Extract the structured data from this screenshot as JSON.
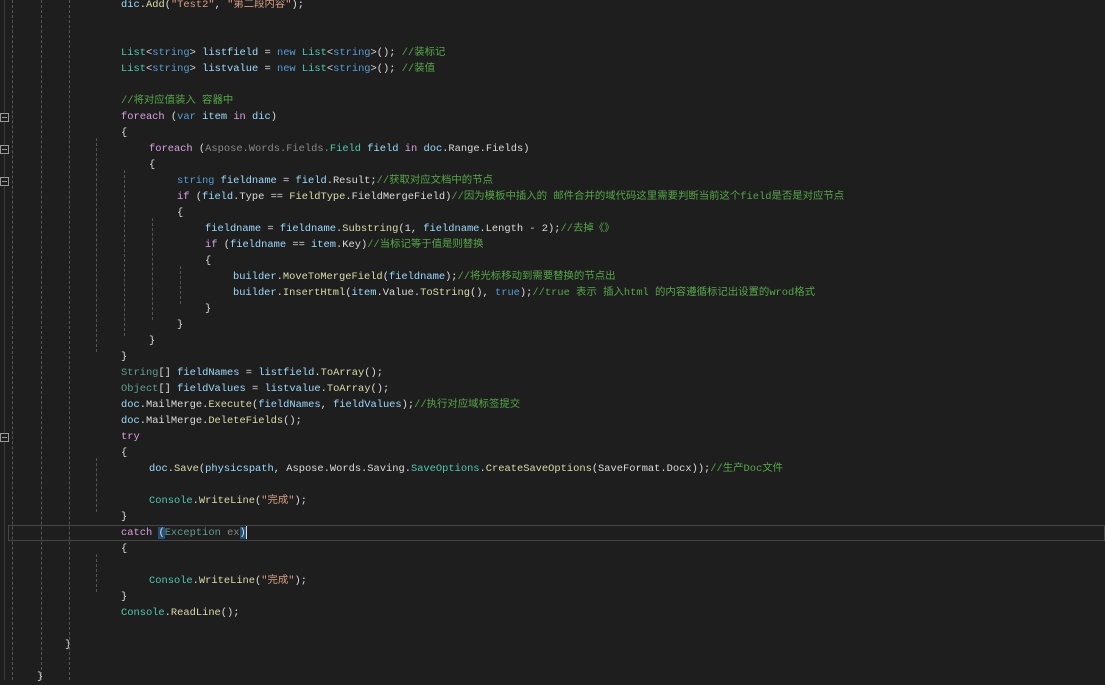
{
  "editor": {
    "current_line": 33,
    "lines": [
      {
        "i": 3,
        "t": [
          [
            "dic",
            "var"
          ],
          [
            ".",
            ""
          ],
          [
            "Add",
            "fn"
          ],
          [
            "(",
            ""
          ],
          [
            "\"Test2\"",
            "str"
          ],
          [
            ", ",
            ""
          ],
          [
            "\"第二段内容\"",
            "str"
          ],
          [
            ");",
            ""
          ]
        ]
      },
      {
        "i": 0,
        "t": []
      },
      {
        "i": 0,
        "t": []
      },
      {
        "i": 3,
        "t": [
          [
            "List",
            "typ"
          ],
          [
            "<",
            ""
          ],
          [
            "string",
            "kw"
          ],
          [
            "> ",
            ""
          ],
          [
            "listfield",
            "var"
          ],
          [
            " = ",
            ""
          ],
          [
            "new",
            "kw"
          ],
          [
            " ",
            ""
          ],
          [
            "List",
            "typ"
          ],
          [
            "<",
            ""
          ],
          [
            "string",
            "kw"
          ],
          [
            ">(); ",
            ""
          ],
          [
            "//装标记",
            "cmt"
          ]
        ]
      },
      {
        "i": 3,
        "t": [
          [
            "List",
            "typ"
          ],
          [
            "<",
            ""
          ],
          [
            "string",
            "kw"
          ],
          [
            "> ",
            ""
          ],
          [
            "listvalue",
            "var"
          ],
          [
            " = ",
            ""
          ],
          [
            "new",
            "kw"
          ],
          [
            " ",
            ""
          ],
          [
            "List",
            "typ"
          ],
          [
            "<",
            ""
          ],
          [
            "string",
            "kw"
          ],
          [
            ">(); ",
            ""
          ],
          [
            "//装值",
            "cmt"
          ]
        ]
      },
      {
        "i": 0,
        "t": []
      },
      {
        "i": 3,
        "t": [
          [
            "//将对应值装入 容器中",
            "cmt"
          ]
        ]
      },
      {
        "i": 3,
        "t": [
          [
            "foreach",
            "ctl"
          ],
          [
            " (",
            ""
          ],
          [
            "var",
            "kw"
          ],
          [
            " ",
            ""
          ],
          [
            "item",
            "var"
          ],
          [
            " ",
            ""
          ],
          [
            "in",
            "ctl"
          ],
          [
            " ",
            ""
          ],
          [
            "dic",
            "var"
          ],
          [
            ")",
            ""
          ]
        ]
      },
      {
        "i": 3,
        "t": [
          [
            "{",
            ""
          ]
        ]
      },
      {
        "i": 4,
        "t": [
          [
            "foreach",
            "ctl"
          ],
          [
            " (",
            ""
          ],
          [
            "Aspose.Words.Fields.",
            "dim"
          ],
          [
            "Field",
            "typ"
          ],
          [
            " ",
            ""
          ],
          [
            "field",
            "var"
          ],
          [
            " ",
            ""
          ],
          [
            "in",
            "ctl"
          ],
          [
            " ",
            ""
          ],
          [
            "doc",
            "var"
          ],
          [
            ".Range.Fields)",
            ""
          ]
        ]
      },
      {
        "i": 4,
        "t": [
          [
            "{",
            ""
          ]
        ]
      },
      {
        "i": 5,
        "t": [
          [
            "string",
            "kw"
          ],
          [
            " ",
            ""
          ],
          [
            "fieldname",
            "var"
          ],
          [
            " = ",
            ""
          ],
          [
            "field",
            "var"
          ],
          [
            ".Result;",
            ""
          ],
          [
            "//获取对应文档中的节点",
            "cmt"
          ]
        ]
      },
      {
        "i": 5,
        "t": [
          [
            "if",
            "ctl"
          ],
          [
            " (",
            ""
          ],
          [
            "field",
            "var"
          ],
          [
            ".Type == ",
            ""
          ],
          [
            "FieldType",
            "fn"
          ],
          [
            ".FieldMergeField)",
            ""
          ],
          [
            "//因为模板中插入的 邮件合并的域代码这里需要判断当前这个field是否是对应节点",
            "cmt"
          ]
        ]
      },
      {
        "i": 5,
        "t": [
          [
            "{",
            ""
          ]
        ]
      },
      {
        "i": 6,
        "t": [
          [
            "fieldname",
            "var"
          ],
          [
            " = ",
            ""
          ],
          [
            "fieldname",
            "var"
          ],
          [
            ".",
            ""
          ],
          [
            "Substring",
            "fn"
          ],
          [
            "(1, ",
            ""
          ],
          [
            "fieldname",
            "var"
          ],
          [
            ".Length - 2);",
            ""
          ],
          [
            "//去掉《》",
            "cmt"
          ]
        ]
      },
      {
        "i": 6,
        "t": [
          [
            "if",
            "ctl"
          ],
          [
            " (",
            ""
          ],
          [
            "fieldname",
            "var"
          ],
          [
            " == ",
            ""
          ],
          [
            "item",
            "var"
          ],
          [
            ".Key)",
            ""
          ],
          [
            "//当标记等于值是则替换",
            "cmt"
          ]
        ]
      },
      {
        "i": 6,
        "t": [
          [
            "{",
            ""
          ]
        ]
      },
      {
        "i": 7,
        "t": [
          [
            "builder",
            "var"
          ],
          [
            ".",
            ""
          ],
          [
            "MoveToMergeField",
            "fn"
          ],
          [
            "(",
            ""
          ],
          [
            "fieldname",
            "var"
          ],
          [
            ");",
            ""
          ],
          [
            "//将光标移动到需要替换的节点出",
            "cmt"
          ]
        ]
      },
      {
        "i": 7,
        "t": [
          [
            "builder",
            "var"
          ],
          [
            ".",
            ""
          ],
          [
            "InsertHtml",
            "fn"
          ],
          [
            "(",
            ""
          ],
          [
            "item",
            "var"
          ],
          [
            ".Value.",
            ""
          ],
          [
            "ToString",
            "fn"
          ],
          [
            "(), ",
            ""
          ],
          [
            "true",
            "kw"
          ],
          [
            ");",
            ""
          ],
          [
            "//true 表示 插入html 的内容遵循标记出设置的wrod格式",
            "cmt"
          ]
        ]
      },
      {
        "i": 6,
        "t": [
          [
            "}",
            ""
          ]
        ]
      },
      {
        "i": 5,
        "t": [
          [
            "}",
            ""
          ]
        ]
      },
      {
        "i": 4,
        "t": [
          [
            "}",
            ""
          ]
        ]
      },
      {
        "i": 3,
        "t": [
          [
            "}",
            ""
          ]
        ]
      },
      {
        "i": 3,
        "t": [
          [
            "String",
            "dimtyp"
          ],
          [
            "[] ",
            ""
          ],
          [
            "fieldNames",
            "var"
          ],
          [
            " = ",
            ""
          ],
          [
            "listfield",
            "var"
          ],
          [
            ".",
            ""
          ],
          [
            "ToArray",
            "fn"
          ],
          [
            "();",
            ""
          ]
        ]
      },
      {
        "i": 3,
        "t": [
          [
            "Object",
            "dimtyp"
          ],
          [
            "[] ",
            ""
          ],
          [
            "fieldValues",
            "var"
          ],
          [
            " = ",
            ""
          ],
          [
            "listvalue",
            "var"
          ],
          [
            ".",
            ""
          ],
          [
            "ToArray",
            "fn"
          ],
          [
            "();",
            ""
          ]
        ]
      },
      {
        "i": 3,
        "t": [
          [
            "doc",
            "var"
          ],
          [
            ".MailMerge.",
            ""
          ],
          [
            "Execute",
            "fn"
          ],
          [
            "(",
            ""
          ],
          [
            "fieldNames",
            "var"
          ],
          [
            ", ",
            ""
          ],
          [
            "fieldValues",
            "var"
          ],
          [
            ");",
            ""
          ],
          [
            "//执行对应域标签提交",
            "cmt"
          ]
        ]
      },
      {
        "i": 3,
        "t": [
          [
            "doc",
            "var"
          ],
          [
            ".MailMerge.",
            ""
          ],
          [
            "DeleteFields",
            "fn"
          ],
          [
            "();",
            ""
          ]
        ]
      },
      {
        "i": 3,
        "t": [
          [
            "try",
            "ctl"
          ]
        ]
      },
      {
        "i": 3,
        "t": [
          [
            "{",
            ""
          ]
        ]
      },
      {
        "i": 4,
        "t": [
          [
            "doc",
            "var"
          ],
          [
            ".",
            ""
          ],
          [
            "Save",
            "fn"
          ],
          [
            "(",
            ""
          ],
          [
            "physicspath",
            "var"
          ],
          [
            ", Aspose.Words.Saving.",
            ""
          ],
          [
            "SaveOptions",
            "typ"
          ],
          [
            ".",
            ""
          ],
          [
            "CreateSaveOptions",
            "fn"
          ],
          [
            "(SaveFormat.Docx));",
            ""
          ],
          [
            "//生产Doc文件",
            "cmt"
          ]
        ]
      },
      {
        "i": 0,
        "t": []
      },
      {
        "i": 4,
        "t": [
          [
            "Console",
            "typ"
          ],
          [
            ".",
            ""
          ],
          [
            "WriteLine",
            "fn"
          ],
          [
            "(",
            ""
          ],
          [
            "\"完成\"",
            "str"
          ],
          [
            ");",
            ""
          ]
        ]
      },
      {
        "i": 3,
        "t": [
          [
            "}",
            ""
          ]
        ]
      },
      {
        "i": 3,
        "t": [
          [
            "catch",
            "ctl"
          ],
          [
            " ",
            ""
          ],
          [
            "(",
            "sel"
          ],
          [
            "Exception",
            "dimtyp"
          ],
          [
            " ",
            ""
          ],
          [
            "ex",
            "dim"
          ],
          [
            ")",
            "sel"
          ]
        ]
      },
      {
        "i": 3,
        "t": [
          [
            "{",
            ""
          ]
        ]
      },
      {
        "i": 0,
        "t": []
      },
      {
        "i": 4,
        "t": [
          [
            "Console",
            "typ"
          ],
          [
            ".",
            ""
          ],
          [
            "WriteLine",
            "fn"
          ],
          [
            "(",
            ""
          ],
          [
            "\"完成\"",
            "str"
          ],
          [
            ");",
            ""
          ]
        ]
      },
      {
        "i": 3,
        "t": [
          [
            "}",
            ""
          ]
        ]
      },
      {
        "i": 3,
        "t": [
          [
            "Console",
            "typ"
          ],
          [
            ".",
            ""
          ],
          [
            "ReadLine",
            "fn"
          ],
          [
            "();",
            ""
          ]
        ]
      },
      {
        "i": 0,
        "t": []
      },
      {
        "i": 1,
        "t": [
          [
            "}",
            ""
          ]
        ]
      },
      {
        "i": 0,
        "t": []
      },
      {
        "i": 0,
        "t": [
          [
            "}",
            ""
          ]
        ]
      }
    ],
    "fold_lines": [
      7,
      9,
      11,
      27
    ]
  }
}
